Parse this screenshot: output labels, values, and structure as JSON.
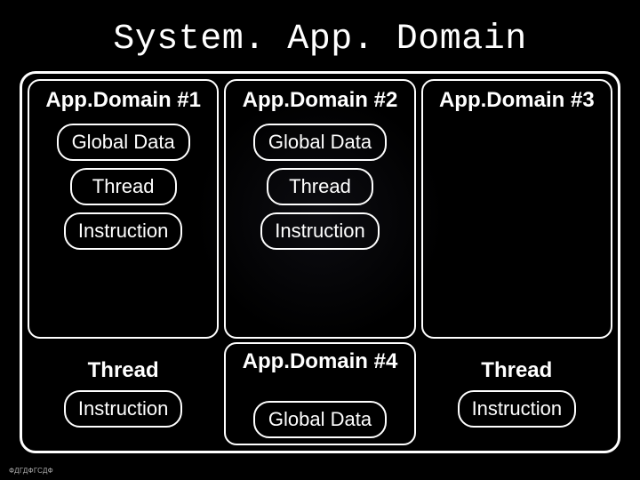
{
  "title": "System. App. Domain",
  "domains": {
    "d1": {
      "title": "App.Domain #1",
      "global": "Global Data",
      "thread": "Thread",
      "instruction": "Instruction"
    },
    "d2": {
      "title": "App.Domain #2",
      "global": "Global Data",
      "thread": "Thread",
      "instruction": "Instruction"
    },
    "d3": {
      "title": "App.Domain #3"
    },
    "d4": {
      "title": "App.Domain #4",
      "global": "Global Data"
    }
  },
  "bottom_left": {
    "thread": "Thread",
    "instruction": "Instruction"
  },
  "bottom_right": {
    "thread": "Thread",
    "instruction": "Instruction"
  },
  "footer": "ФДГДФГСДФ"
}
